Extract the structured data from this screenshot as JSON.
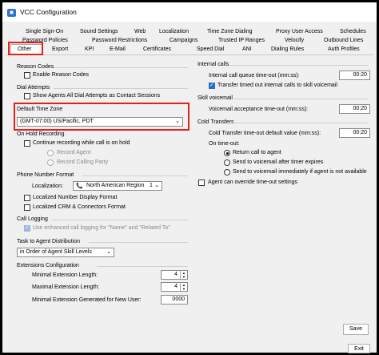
{
  "window": {
    "title": "VCC Configuration"
  },
  "tabs": {
    "row1": [
      "Single Sign-On",
      "Sound Settings",
      "Web",
      "Localization",
      "Time Zone Dialing",
      "Proxy User Access",
      "Schedules"
    ],
    "row2": [
      "Password Policies",
      "Password Restrictions",
      "Campaigns",
      "Trusted IP Ranges",
      "Velocify",
      "Outbound Lines"
    ],
    "row3": [
      "Other",
      "Export",
      "KPI",
      "E-Mail",
      "Certificates",
      "Speed Dial",
      "ANI",
      "Dialing Rules",
      "Auth Profiles"
    ],
    "active": "Other"
  },
  "left": {
    "reason_codes": {
      "heading": "Reason Codes",
      "enable_label": "Enable Reason Codes"
    },
    "dial_attempts": {
      "heading": "Dial Attempts",
      "show_label": "Show Agents All Dial Attempts as Contact Sessions"
    },
    "default_tz": {
      "heading": "Default Time Zone",
      "value": "(GMT-07:00) US/Pacific, PDT"
    },
    "on_hold": {
      "heading": "On Hold Recording",
      "continue_label": "Continue recording while call is on hold",
      "record_agent": "Record Agent",
      "record_calling_party": "Record Calling Party"
    },
    "phone_format": {
      "heading": "Phone Number Format",
      "localization_label": "Localization:",
      "region_value": "North American Region",
      "region_number": "1",
      "localized_display": "Localized Number Display Format",
      "localized_crm": "Localized CRM & Connectors Format"
    },
    "call_logging": {
      "heading": "Call Logging",
      "enhanced_label": "Use enhanced call logging for \"Name\" and \"Related To\""
    },
    "task_dist": {
      "heading": "Task to Agent Distribution",
      "value": "in Order of Agent Skill Levels"
    },
    "extensions": {
      "heading": "Extensions Configuration",
      "min_label": "Minimal Extension Length:",
      "min_value": "4",
      "max_label": "Maximal Extension Length:",
      "max_value": "4",
      "new_user_label": "Minimal Extension Generated for New User:",
      "new_user_value": "0000"
    }
  },
  "right": {
    "internal_calls": {
      "heading": "Internal calls",
      "queue_timeout_label": "Internal call queue time-out (mm:ss):",
      "queue_timeout_value": "00:20",
      "transfer_label": "Transfer timed out internal calls to skill voicemail"
    },
    "skill_voicemail": {
      "heading": "Skill voicemail",
      "accept_label": "Voicemail acceptance time-out (mm:ss):",
      "accept_value": "00:20"
    },
    "cold_transfers": {
      "heading": "Cold Transfers",
      "default_label": "Cold Transfer time-out default value (mm:ss):",
      "default_value": "00:20",
      "on_timeout": "On time-out:",
      "return_agent": "Return call to agent",
      "send_vm_after": "Send to voicemail after timer expires",
      "send_vm_immediately": "Send to voicemail immediately if agent is not available",
      "override_label": "Agent can override time-out settings"
    }
  },
  "buttons": {
    "save": "Save",
    "exit": "Exit"
  },
  "colors": {
    "highlight": "#e0201b",
    "checkbox_checked": "#2b6cc8",
    "radio_enabled": "#000000"
  }
}
